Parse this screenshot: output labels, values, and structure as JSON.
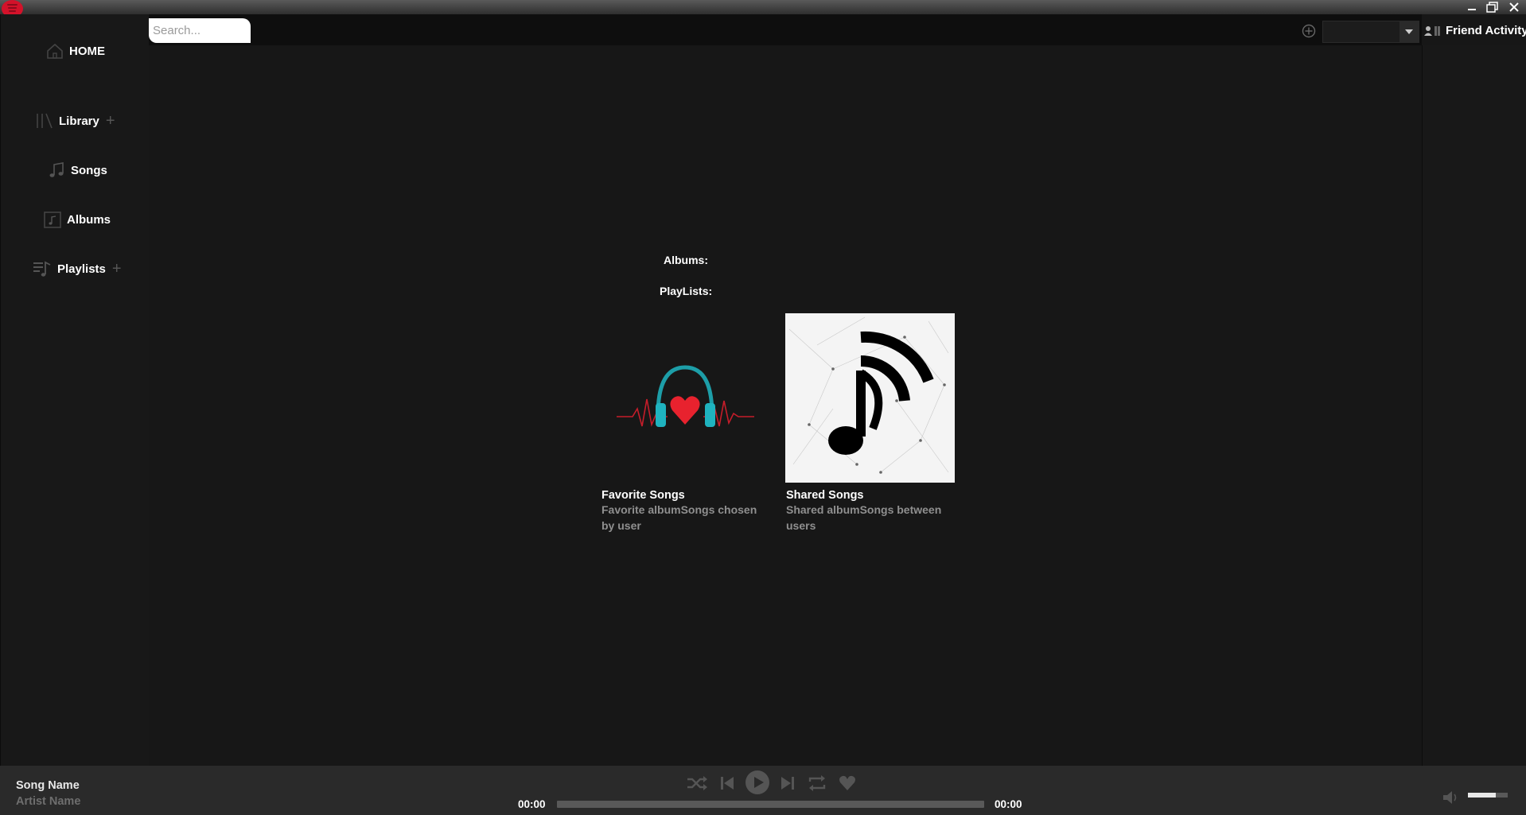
{
  "window": {
    "title_controls": [
      "minimize",
      "maximize",
      "close"
    ]
  },
  "sidebar": {
    "items": [
      {
        "label": "HOME",
        "icon": "home-icon",
        "has_add": false
      },
      {
        "label": "Library",
        "icon": "library-icon",
        "has_add": true
      },
      {
        "label": "Songs",
        "icon": "music-note-icon",
        "has_add": false
      },
      {
        "label": "Albums",
        "icon": "album-icon",
        "has_add": false
      },
      {
        "label": "Playlists",
        "icon": "playlist-icon",
        "has_add": true
      }
    ],
    "add_symbol": "+"
  },
  "topbar": {
    "search_placeholder": "Search...",
    "dropdown_value": "",
    "friend_activity_label": "Friend Activity"
  },
  "main": {
    "albums_label": "Albums:",
    "playlists_label": "PlayLists:",
    "playlists": [
      {
        "name": "Favorite Songs",
        "description": "Favorite albumSongs chosen by user",
        "art": "headphones-heart-art"
      },
      {
        "name": "Shared Songs",
        "description": "Shared albumSongs between users",
        "art": "shared-music-note-art"
      }
    ]
  },
  "player": {
    "song_name": "Song Name",
    "artist_name": "Artist Name",
    "current_time": "00:00",
    "total_time": "00:00",
    "progress": 0,
    "volume": 0.7,
    "controls": [
      "shuffle-icon",
      "previous-icon",
      "play-icon",
      "next-icon",
      "repeat-icon",
      "heart-icon"
    ]
  },
  "colors": {
    "accent": "#d3122a",
    "background": "#171717",
    "panel": "#181818",
    "player": "#2a2a2a"
  }
}
